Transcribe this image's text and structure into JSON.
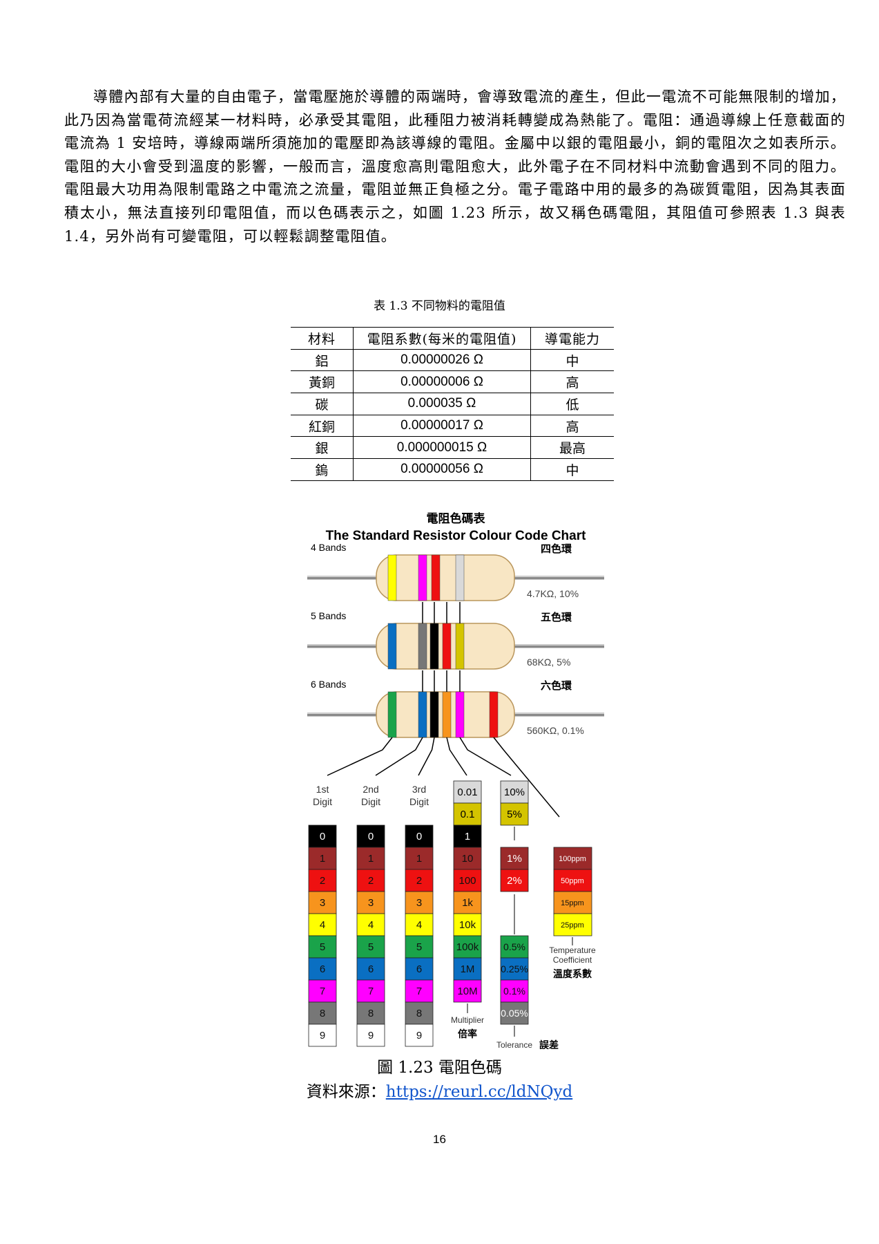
{
  "paragraph": "導體內部有大量的自由電子，當電壓施於導體的兩端時，會導致電流的產生，但此一電流不可能無限制的增加，此乃因為當電荷流經某一材料時，必承受其電阻，此種阻力被消耗轉變成為熱能了。電阻：通過導線上任意截面的電流為 1 安培時，導線兩端所須施加的電壓即為該導線的電阻。金屬中以銀的電阻最小，銅的電阻次之如表所示。電阻的大小會受到溫度的影響，一般而言，溫度愈高則電阻愈大，此外電子在不同材料中流動會遇到不同的阻力。電阻最大功用為限制電路之中電流之流量，電阻並無正負極之分。電子電路中用的最多的為碳質電阻，因為其表面積太小，無法直接列印電阻值，而以色碼表示之，如圖 1.23 所示，故又稱色碼電阻，其阻值可參照表 1.3 與表 1.4，另外尚有可變電阻，可以輕鬆調整電阻值。",
  "table": {
    "caption": "表 1.3 不同物料的電阻值",
    "headers": [
      "材料",
      "電阻系數(每米的電阻值)",
      "導電能力"
    ],
    "rows": [
      [
        "鋁",
        "0.00000026 Ω",
        "中"
      ],
      [
        "黃銅",
        "0.00000006 Ω",
        "高"
      ],
      [
        "碳",
        "0.000035 Ω",
        "低"
      ],
      [
        "紅銅",
        "0.00000017 Ω",
        "高"
      ],
      [
        "銀",
        "0.000000015 Ω",
        "最高"
      ],
      [
        "鎢",
        "0.00000056 Ω",
        "中"
      ]
    ]
  },
  "chart": {
    "title_zh": "電阻色碼表",
    "title_en": "The Standard Resistor Colour Code Chart",
    "resistors": [
      {
        "label": "4 Bands",
        "zh": "四色環",
        "value": "4.7KΩ, 10%"
      },
      {
        "label": "5 Bands",
        "zh": "五色環",
        "value": "68KΩ, 5%"
      },
      {
        "label": "6 Bands",
        "zh": "六色環",
        "value": "560KΩ, 0.1%"
      }
    ],
    "column_labels": [
      [
        "1st",
        "Digit"
      ],
      [
        "2nd",
        "Digit"
      ],
      [
        "3rd",
        "Digit"
      ]
    ],
    "digits": [
      "0",
      "1",
      "2",
      "3",
      "4",
      "5",
      "6",
      "7",
      "8",
      "9"
    ],
    "colors": [
      "#000000",
      "#9b2a2a",
      "#ee1111",
      "#f7941d",
      "#ffff00",
      "#1aa34a",
      "#0a6fc2",
      "#ff00ff",
      "#777777",
      "#ffffff"
    ],
    "multiplier_top": [
      "0.01",
      "0.1"
    ],
    "multiplier_top_colors": [
      "#d9d9d9",
      "#d4c400"
    ],
    "multiplier": [
      "1",
      "10",
      "100",
      "1k",
      "10k",
      "100k",
      "1M",
      "10M"
    ],
    "multiplier_label": "Multiplier",
    "multiplier_zh": "倍率",
    "tolerance_top": [
      "10%",
      "5%"
    ],
    "tolerance_top_colors": [
      "#d9d9d9",
      "#d4c400"
    ],
    "tolerance_mid": [
      "1%",
      "2%"
    ],
    "tolerance_mid_colors": [
      "#9b2a2a",
      "#ee1111"
    ],
    "tolerance_low": [
      "0.5%",
      "0.25%",
      "0.1%",
      "0.05%"
    ],
    "tolerance_low_colors": [
      "#1aa34a",
      "#0a6fc2",
      "#ff00ff",
      "#777777"
    ],
    "tolerance_label": "Tolerance",
    "tolerance_zh": "誤差",
    "tempco": [
      "100ppm",
      "50ppm",
      "15ppm",
      "25ppm"
    ],
    "tempco_colors": [
      "#9b2a2a",
      "#ee1111",
      "#f7941d",
      "#ffff00"
    ],
    "tempco_label": [
      "Temperature",
      "Coefficient"
    ],
    "tempco_zh": "溫度系數"
  },
  "figure_caption": "圖 1.23 電阻色碼",
  "source_label": "資料來源：",
  "source_url": "https://reurl.cc/ldNQyd",
  "page_number": "16"
}
